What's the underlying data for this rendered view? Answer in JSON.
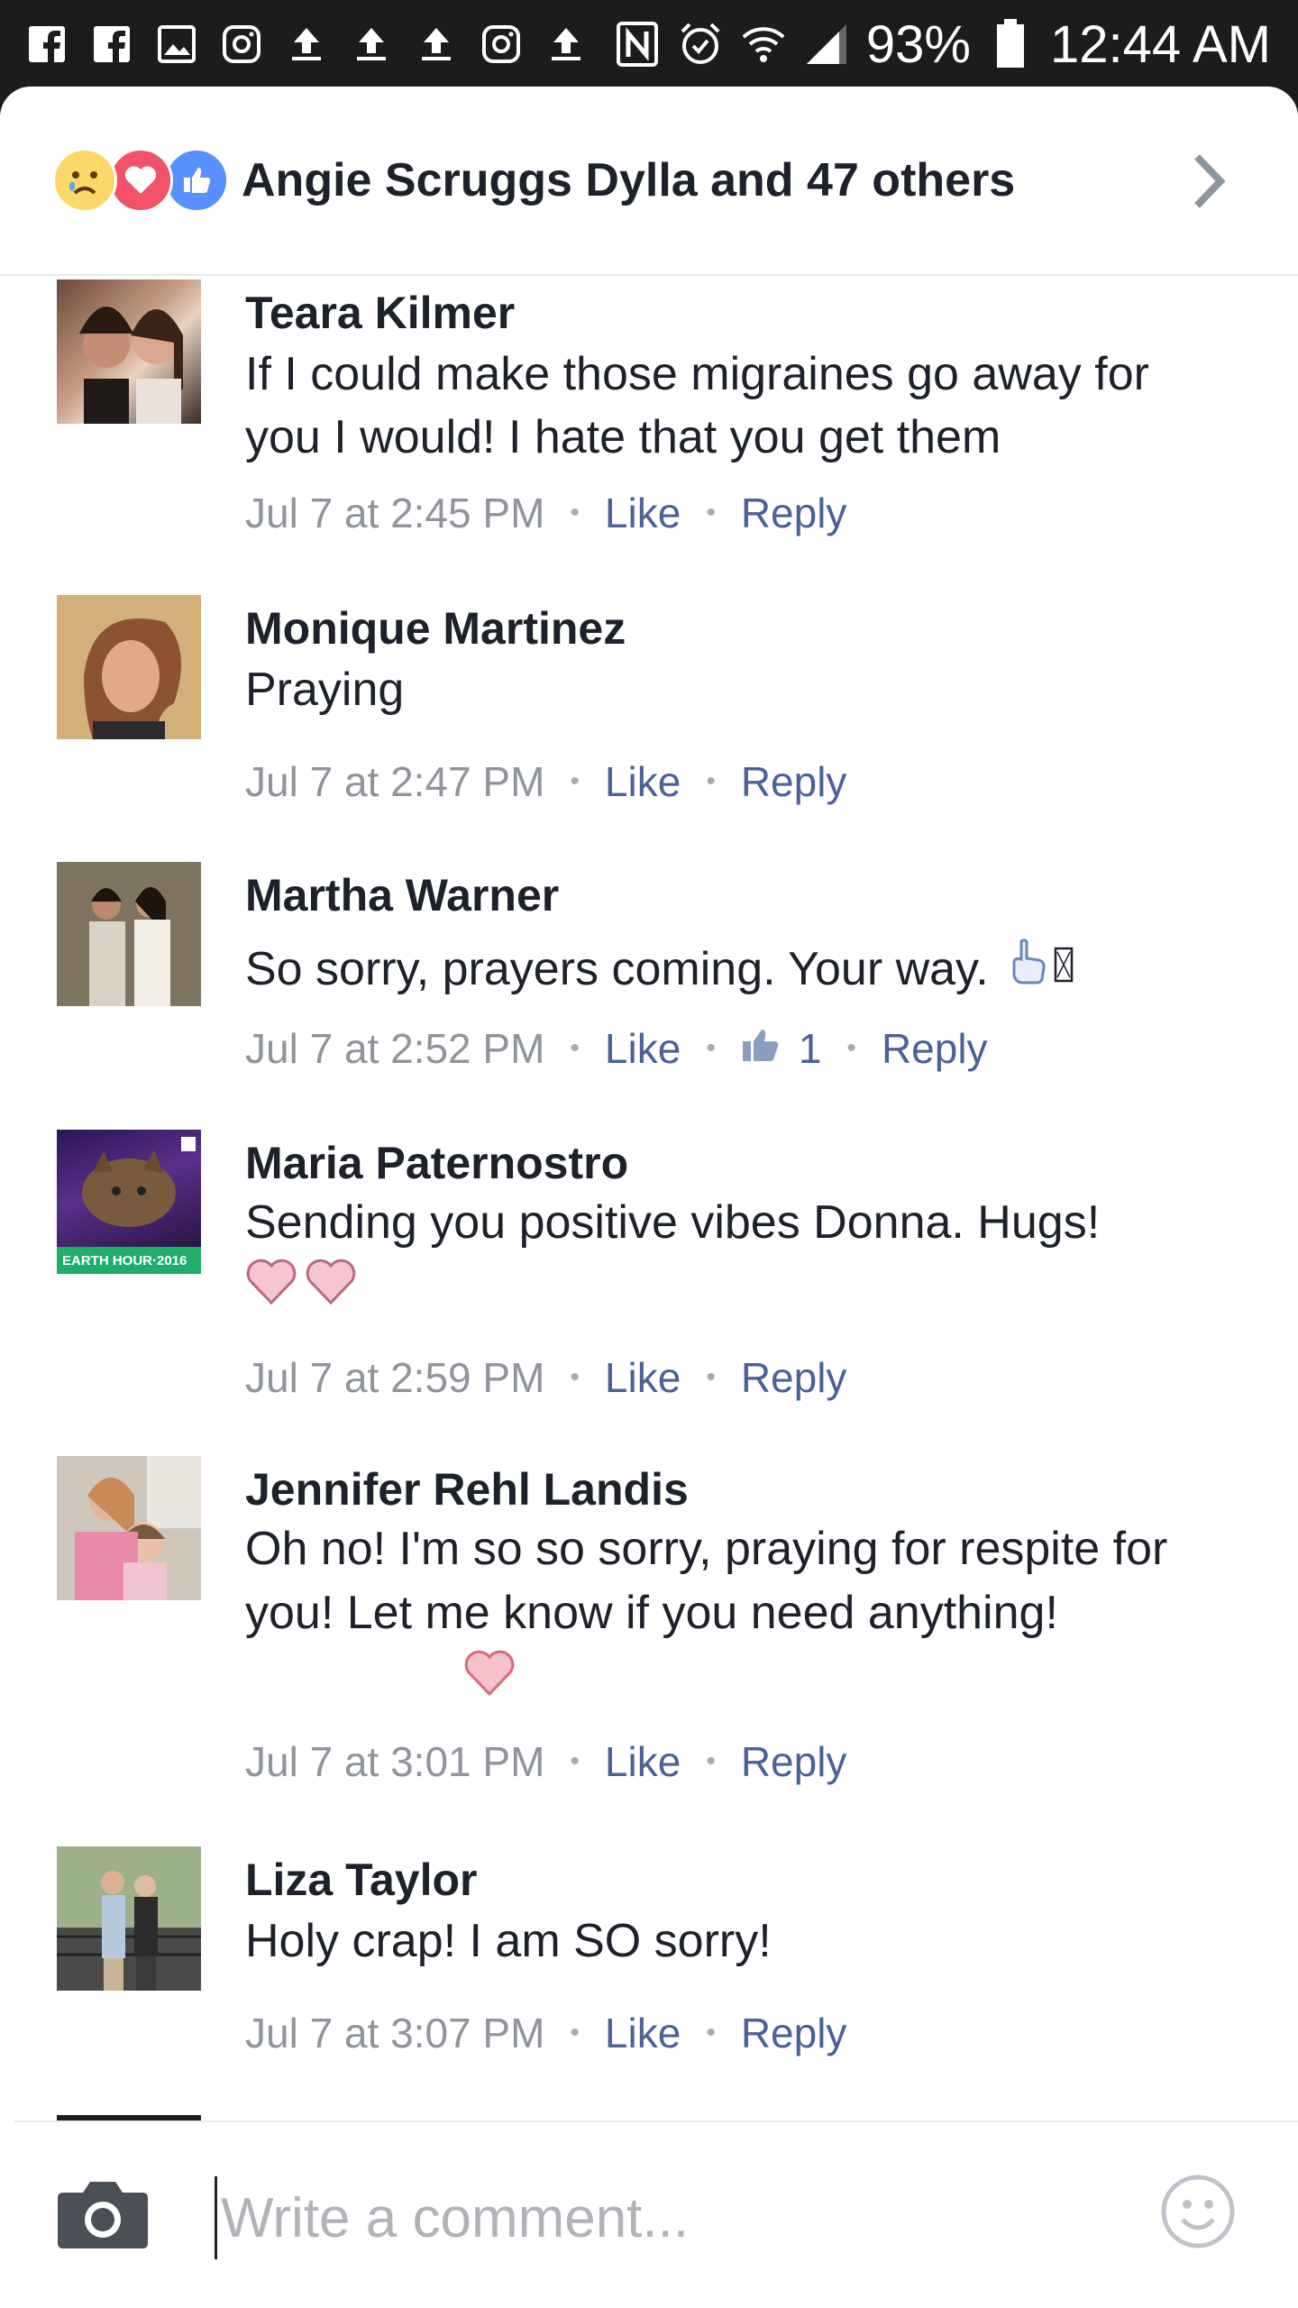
{
  "status_bar": {
    "battery": "93%",
    "time": "12:44 AM",
    "notification_icons": [
      "facebook-icon",
      "facebook-icon",
      "gallery-icon",
      "instagram-icon",
      "upload-icon",
      "upload-icon",
      "upload-icon",
      "instagram-icon",
      "upload-icon"
    ],
    "system_icons": [
      "nfc-icon",
      "alarm-icon",
      "wifi-icon",
      "signal-icon",
      "battery-icon"
    ]
  },
  "reactions": {
    "summary": "Angie Scruggs Dylla and 47 others",
    "icons": [
      "sad-reaction-icon",
      "love-reaction-icon",
      "like-reaction-icon"
    ]
  },
  "comments": [
    {
      "author": "Teara Kilmer",
      "text": "If I could make those migraines go away for you I would! I hate that you get them",
      "time": "Jul 7 at 2:45 PM",
      "like": "Like",
      "reply": "Reply"
    },
    {
      "author": "Monique Martinez",
      "text": "Praying",
      "time": "Jul 7 at 2:47 PM",
      "like": "Like",
      "reply": "Reply"
    },
    {
      "author": "Martha Warner",
      "text": "So sorry, prayers coming. Your way.",
      "time": "Jul 7 at 2:52 PM",
      "like": "Like",
      "like_count": "1",
      "reply": "Reply"
    },
    {
      "author": "Maria Paternostro",
      "text": "Sending you positive vibes Donna. Hugs!",
      "time": "Jul 7 at 2:59 PM",
      "like": "Like",
      "reply": "Reply",
      "avatar_caption": "EARTH HOUR·2016"
    },
    {
      "author": "Jennifer Rehl Landis",
      "text": "Oh no! I'm so so sorry, praying for respite for  you! Let me know if you need anything!",
      "time": "Jul 7 at 3:01 PM",
      "like": "Like",
      "reply": "Reply"
    },
    {
      "author": "Liza Taylor",
      "text": "Holy crap! I am SO sorry!",
      "time": "Jul 7 at 3:07 PM",
      "like": "Like",
      "reply": "Reply"
    }
  ],
  "composer": {
    "placeholder": "Write a comment..."
  },
  "colors": {
    "link": "#4b6198",
    "meta": "#90949c",
    "text": "#1d2129",
    "like_blue": "#5890ff",
    "love_red": "#f25268",
    "sad_yellow": "#fcd86a"
  }
}
